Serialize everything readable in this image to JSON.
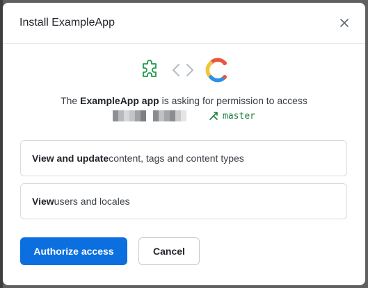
{
  "modal": {
    "title": "Install ExampleApp",
    "close_icon": "close-icon"
  },
  "icons": {
    "left": "puzzle-icon",
    "middle": "code-brackets-icon",
    "right": "contentful-logo-icon"
  },
  "permission": {
    "prefix": "The ",
    "app_name": "ExampleApp app",
    "suffix": " is asking for permission to access",
    "branch_icon": "git-branch-icon",
    "branch": "master"
  },
  "scopes": [
    {
      "bold": "View and update",
      "rest": " content, tags and content types"
    },
    {
      "bold": "View",
      "rest": " users and locales"
    }
  ],
  "actions": {
    "authorize_label": "Authorize access",
    "cancel_label": "Cancel"
  },
  "colors": {
    "primary": "#0b6fe0",
    "branch_green": "#1a7f3c",
    "puzzle_green": "#1a9b4a"
  }
}
